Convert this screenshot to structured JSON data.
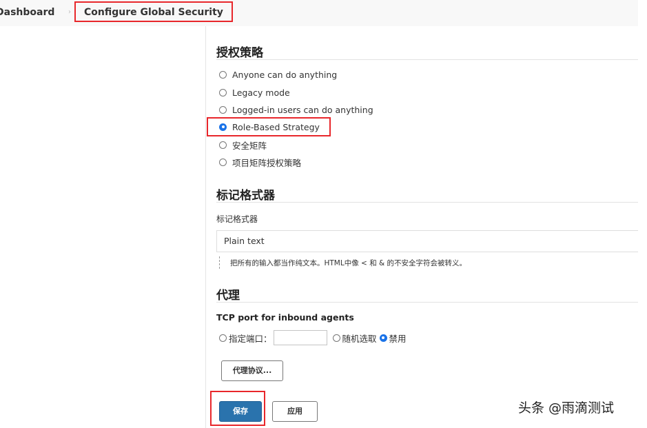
{
  "breadcrumb": {
    "dashboard": "Dashboard",
    "separator": "›",
    "current": "Configure Global Security"
  },
  "authorization": {
    "title": "授权策略",
    "options": [
      {
        "label": "Anyone can do anything",
        "checked": false
      },
      {
        "label": "Legacy mode",
        "checked": false
      },
      {
        "label": "Logged-in users can do anything",
        "checked": false
      },
      {
        "label": "Role-Based Strategy",
        "checked": true
      },
      {
        "label": "安全矩阵",
        "checked": false
      },
      {
        "label": "项目矩阵授权策略",
        "checked": false
      }
    ]
  },
  "markup": {
    "title": "标记格式器",
    "field_label": "标记格式器",
    "selected": "Plain text",
    "help": "把所有的输入都当作纯文本。HTML中像 < 和 & 的不安全字符会被转义。"
  },
  "proxy": {
    "title": "代理",
    "tcp_label": "TCP port for inbound agents",
    "fixed_label": "指定端口：",
    "fixed_value": "",
    "random_label": "随机选取",
    "disable_label": "禁用",
    "selected_option": "disable",
    "protocols_button": "代理协议..."
  },
  "actions": {
    "save": "保存",
    "apply": "应用"
  },
  "watermark": "头条 @雨滴测试",
  "colors": {
    "accent": "#2a73ad",
    "radio_checked": "#1a73e8",
    "highlight": "#e8262a"
  }
}
